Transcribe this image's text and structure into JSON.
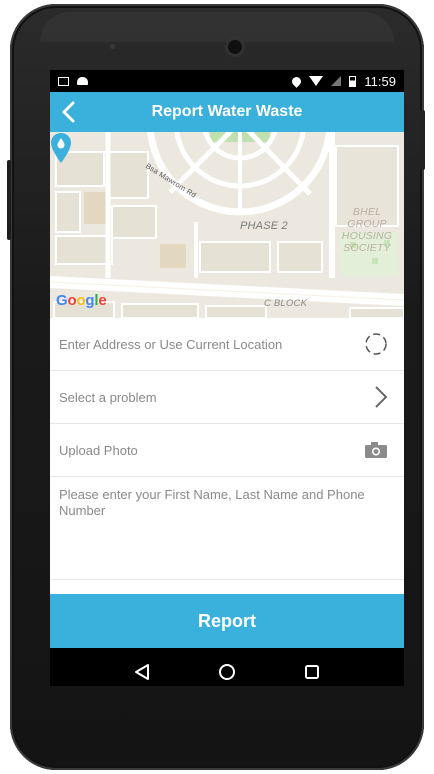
{
  "status_bar": {
    "time": "11:59",
    "icons": [
      "image-icon",
      "android-icon",
      "location-icon",
      "wifi-icon",
      "signal-icon",
      "battery-icon"
    ]
  },
  "app_bar": {
    "title": "Report Water Waste",
    "back_icon": "chevron-left-icon",
    "color": "#3ab0dd"
  },
  "map": {
    "labels": {
      "phase": "PHASE 2",
      "bhel": "BHEL GROUP HOUSING SOCIETY",
      "cblock": "C BLOCK",
      "road": "Bsa Mawrom Rd"
    },
    "attribution": [
      "G",
      "o",
      "o",
      "g",
      "l",
      "e"
    ],
    "pin_icon": "map-pin-icon"
  },
  "form": {
    "address": {
      "placeholder": "Enter Address or Use Current Location",
      "value": "",
      "icon": "current-location-icon"
    },
    "problem": {
      "label": "Select a problem",
      "icon": "chevron-right-icon"
    },
    "photo": {
      "label": "Upload Photo",
      "icon": "camera-icon"
    },
    "contact": {
      "placeholder": "Please enter your First Name, Last Name and Phone Number",
      "value": ""
    }
  },
  "report_button": {
    "label": "Report",
    "color": "#3ab0dd"
  },
  "nav_bar": {
    "icons": [
      "back-triangle-icon",
      "home-circle-icon",
      "recents-square-icon"
    ]
  }
}
